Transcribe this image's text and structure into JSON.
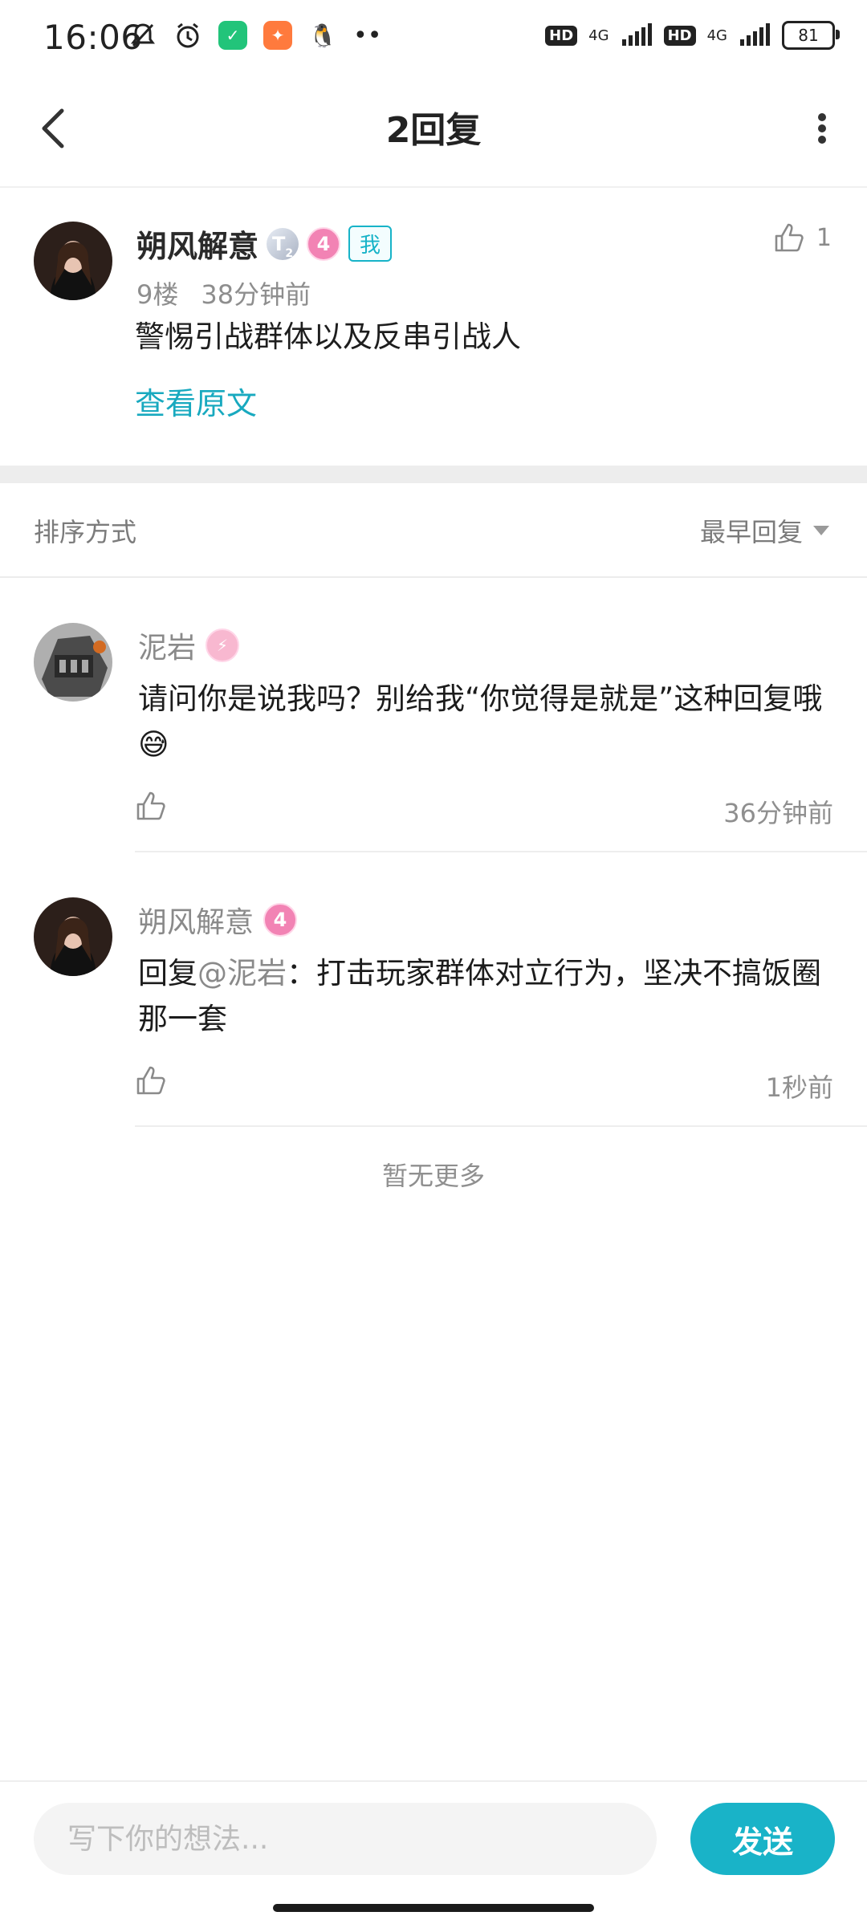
{
  "status_bar": {
    "time": "16:06",
    "network_1": "4G",
    "network_2": "4G",
    "hd_label": "HD",
    "battery": "81"
  },
  "header": {
    "title": "2回复"
  },
  "original_comment": {
    "author": "朔风解意",
    "level": "4",
    "title_badge": "T",
    "title_badge_sub": "2",
    "me_tag": "我",
    "floor": "9楼",
    "time": "38分钟前",
    "likes": "1",
    "text": "警惕引战群体以及反串引战人",
    "view_original": "查看原文"
  },
  "sort": {
    "label": "排序方式",
    "value": "最早回复"
  },
  "replies": [
    {
      "author": "泥岩",
      "text": "请问你是说我吗？别给我“你觉得是就是”这种回复哦😅",
      "time": "36分钟前"
    },
    {
      "author": "朔风解意",
      "level": "4",
      "reply_prefix": "回复",
      "mention": "@泥岩",
      "text": "：打击玩家群体对立行为，坚决不搞饭圈那一套",
      "time": "1秒前"
    }
  ],
  "no_more": "暂无更多",
  "input": {
    "placeholder": "写下你的想法..."
  },
  "send_label": "发送",
  "colors": {
    "accent": "#19b3c8",
    "link": "#18a9bf",
    "level_badge": "#f283b4"
  }
}
